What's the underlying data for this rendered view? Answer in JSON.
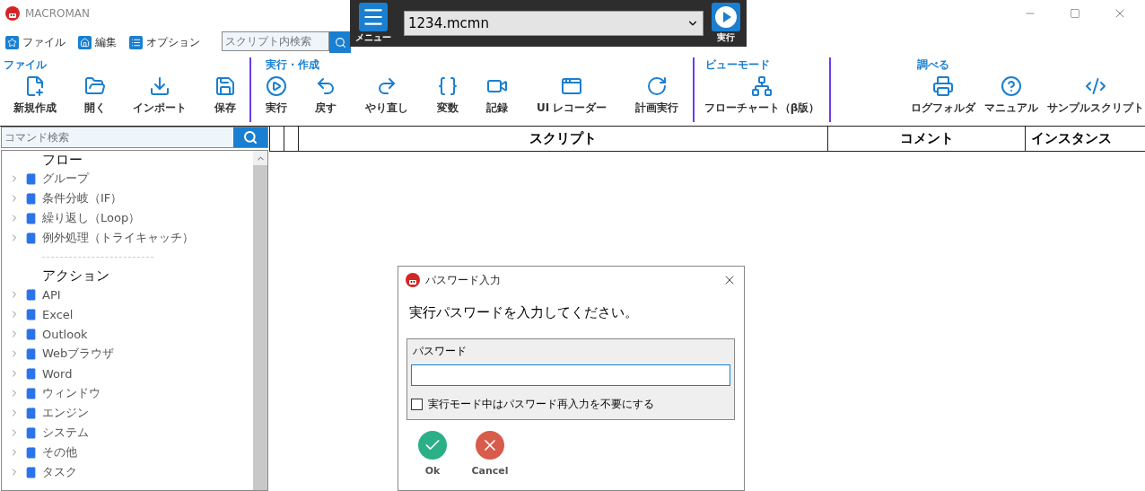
{
  "window": {
    "title": "MACROMAN"
  },
  "menu": [
    {
      "label": "ファイル",
      "kind": "star"
    },
    {
      "label": "編集",
      "kind": "home"
    },
    {
      "label": "オプション",
      "kind": "list"
    }
  ],
  "script_search": {
    "placeholder": "スクリプト内検索"
  },
  "run_bar": {
    "menu_label": "メニュー",
    "file": "1234.mcmn",
    "run_label": "実行"
  },
  "ribbon": [
    {
      "label": "ファイル",
      "buttons": [
        {
          "label": "新規作成",
          "kind": "new"
        },
        {
          "label": "開く",
          "kind": "open"
        },
        {
          "label": "インポート",
          "kind": "import"
        },
        {
          "label": "保存",
          "kind": "save"
        }
      ]
    },
    {
      "label": "実行・作成",
      "buttons": [
        {
          "label": "実行",
          "kind": "run"
        },
        {
          "label": "戻す",
          "kind": "undo"
        },
        {
          "label": "やり直し",
          "kind": "redo"
        },
        {
          "label": "変数",
          "kind": "variable"
        },
        {
          "label": "記録",
          "kind": "record"
        },
        {
          "label": "UI レコーダー",
          "kind": "uirec"
        },
        {
          "label": "計画実行",
          "kind": "schedule"
        }
      ]
    },
    {
      "label": "ビューモード",
      "buttons": [
        {
          "label": "フローチャート（β版）",
          "kind": "flow"
        }
      ]
    },
    {
      "label": "調べる",
      "buttons": [
        {
          "label": "ログフォルダ",
          "kind": "log"
        },
        {
          "label": "マニュアル",
          "kind": "help"
        },
        {
          "label": "サンプルスクリプト",
          "kind": "sample"
        }
      ]
    }
  ],
  "command_search": {
    "placeholder": "コマンド検索"
  },
  "command_tree": [
    {
      "title": "フロー",
      "items": [
        {
          "label": "グループ",
          "expanded": false
        },
        {
          "label": "条件分岐（IF）",
          "expanded": false
        },
        {
          "label": "繰り返し（Loop）",
          "expanded": false
        },
        {
          "label": "例外処理（トライキャッチ）",
          "expanded": false
        }
      ]
    },
    {
      "title": "アクション",
      "items": [
        {
          "label": "API",
          "expanded": false
        },
        {
          "label": "Excel",
          "expanded": false
        },
        {
          "label": "Outlook",
          "expanded": false
        },
        {
          "label": "Webブラウザ",
          "expanded": false
        },
        {
          "label": "Word",
          "expanded": false
        },
        {
          "label": "ウィンドウ",
          "expanded": false
        },
        {
          "label": "エンジン",
          "expanded": false
        },
        {
          "label": "システム",
          "expanded": false
        },
        {
          "label": "その他",
          "expanded": false
        },
        {
          "label": "タスク",
          "expanded": false
        }
      ]
    }
  ],
  "table": {
    "columns": [
      "スクリプト",
      "コメント",
      "インスタンス"
    ]
  },
  "dialog": {
    "title": "パスワード入力",
    "message": "実行パスワードを入力してください。",
    "group_label": "パスワード",
    "checkbox": {
      "label": "実行モード中はパスワード再入力を不要にする",
      "checked": false
    },
    "buttons": [
      {
        "label": "Ok",
        "kind": "ok"
      },
      {
        "label": "Cancel",
        "kind": "cancel"
      }
    ]
  }
}
